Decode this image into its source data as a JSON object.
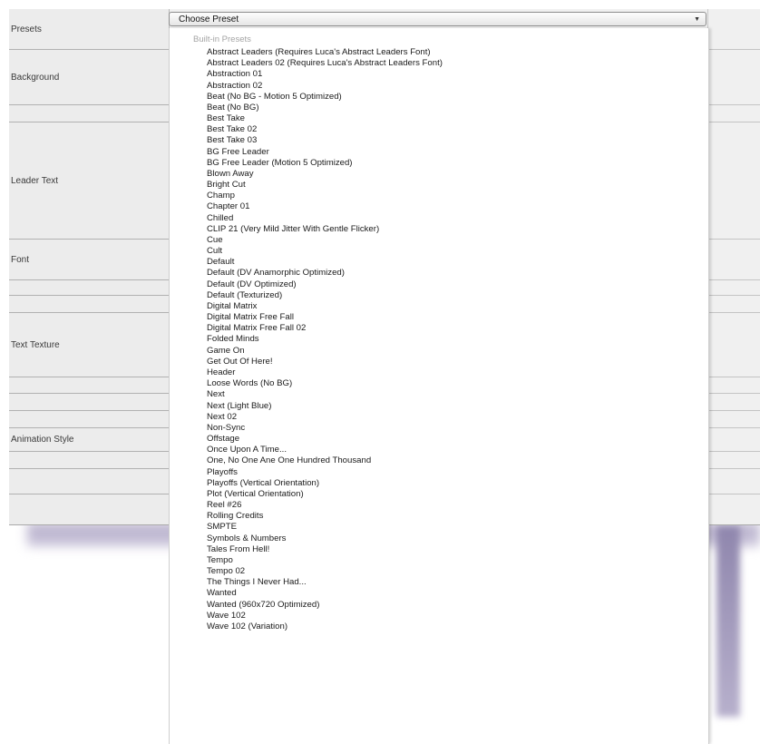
{
  "inspector": {
    "rows": [
      {
        "label": "Presets"
      },
      {
        "label": "Background"
      },
      {
        "label": ""
      },
      {
        "label": "Leader Text"
      },
      {
        "label": "Font"
      },
      {
        "label": ""
      },
      {
        "label": ""
      },
      {
        "label": "Text Texture"
      },
      {
        "label": ""
      },
      {
        "label": ""
      },
      {
        "label": ""
      },
      {
        "label": "Animation Style"
      },
      {
        "label": ""
      },
      {
        "label": ""
      },
      {
        "label": ""
      }
    ]
  },
  "preset_select": {
    "selected": "Choose Preset",
    "icon": "chevron-down-icon"
  },
  "dropdown": {
    "section_header": "Built-in Presets",
    "items": [
      "Abstract Leaders (Requires Luca's Abstract Leaders Font)",
      "Abstract Leaders 02 (Requires Luca's Abstract Leaders Font)",
      "Abstraction 01",
      "Abstraction 02",
      "Beat (No BG - Motion 5 Optimized)",
      "Beat (No BG)",
      "Best Take",
      "Best Take 02",
      "Best Take 03",
      "BG Free Leader",
      "BG Free Leader (Motion 5 Optimized)",
      "Blown Away",
      "Bright Cut",
      "Champ",
      "Chapter 01",
      "Chilled",
      "CLIP 21 (Very Mild Jitter With Gentle Flicker)",
      "Cue",
      "Cult",
      "Default",
      "Default (DV Anamorphic Optimized)",
      "Default (DV Optimized)",
      "Default (Texturized)",
      "Digital Matrix",
      "Digital Matrix Free Fall",
      "Digital Matrix Free Fall 02",
      "Folded Minds",
      "Game On",
      "Get Out Of Here!",
      "Header",
      "Loose Words (No BG)",
      "Next",
      "Next (Light Blue)",
      "Next 02",
      "Non-Sync",
      "Offstage",
      "Once Upon A Time...",
      "One, No One Ane One Hundred Thousand",
      "Playoffs",
      "Playoffs (Vertical Orientation)",
      "Plot (Vertical Orientation)",
      "Reel #26",
      "Rolling Credits",
      "SMPTE",
      "Symbols & Numbers",
      "Tales From Hell!",
      "Tempo",
      "Tempo 02",
      "The Things I Never Had...",
      "Wanted",
      "Wanted (960x720 Optimized)",
      "Wave 102",
      "Wave 102 (Variation)"
    ]
  }
}
